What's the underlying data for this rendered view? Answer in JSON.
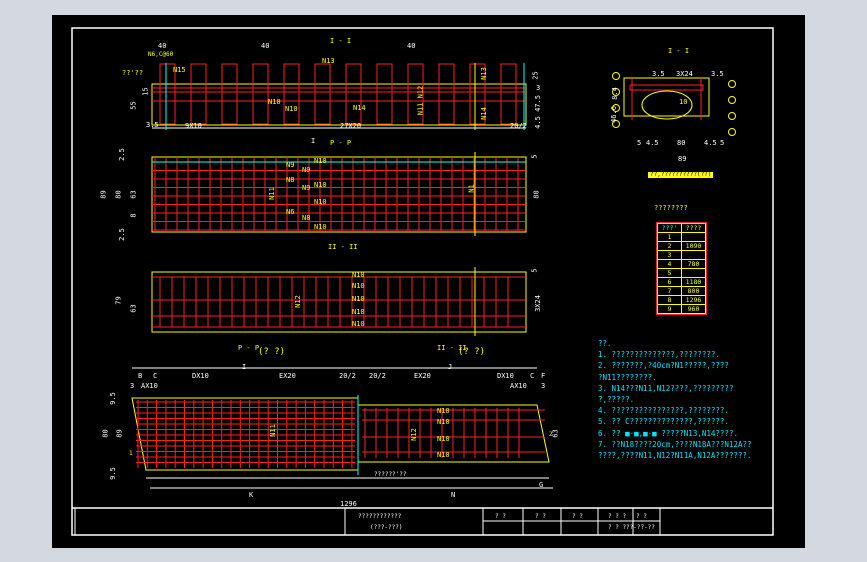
{
  "colors": {
    "background": "#000000",
    "frame": "#ffffff",
    "concrete": "#ffff00",
    "rebar": "#ff2020",
    "axis": "#00ffff",
    "outer": "#d4d8e0"
  },
  "elevation": {
    "title": "I - I",
    "dims_top": [
      "40",
      "40",
      "40"
    ],
    "note_top": "N6,C@60",
    "label_left": "??'??",
    "labels": [
      "N15",
      "N13",
      "N10",
      "N10",
      "N14",
      "N11 N12",
      "N13",
      "N14"
    ],
    "dims_left": [
      "55",
      "15"
    ],
    "dims_right": [
      "25",
      "3",
      "47.5",
      "4.5"
    ],
    "dims_bottom": [
      "3.5",
      "9X10",
      "27X20",
      "20/2"
    ]
  },
  "plan_pp": {
    "title": "P - P",
    "marker": "I",
    "labels": [
      "N9",
      "N9",
      "N10",
      "N8",
      "N9",
      "N10",
      "N11",
      "N6",
      "N8",
      "N10",
      "N10",
      "N1"
    ],
    "dims_left": [
      "2.5",
      "89",
      "80",
      "63",
      "8",
      "2.5"
    ],
    "dims_right": [
      "5",
      "80"
    ]
  },
  "section_ii": {
    "title": "II - II",
    "labels": [
      "N10",
      "N10",
      "N12",
      "N10",
      "N10",
      "N10"
    ],
    "dims_left": [
      "79",
      "63"
    ],
    "dims_right": [
      "5",
      "3X24"
    ]
  },
  "section_i": {
    "title": "I - I",
    "dims_top": [
      "3.5",
      "3X24",
      "3.5"
    ],
    "dims_left": [
      "8.4",
      "46.6"
    ],
    "dims_bottom": [
      "5",
      "4.5",
      "80",
      "4.5",
      "5",
      "89"
    ],
    "center_label": "10",
    "caption": "??,??????????(??)",
    "callouts": [
      "1",
      "2",
      "3",
      "4",
      "5",
      "6",
      "7",
      "8",
      "9",
      "10",
      "11",
      "12",
      "13"
    ]
  },
  "bottom_plan": {
    "title_left": "P - P",
    "title_left_suffix": "(? ?)",
    "title_right": "II - II",
    "title_right_suffix": "(? ?)",
    "dims_top_row1": [
      "I",
      "J"
    ],
    "dims_top_row2": [
      "B",
      "C",
      "DX10",
      "EX20",
      "20/2",
      "20/2",
      "EX20",
      "DX10",
      "C",
      "F"
    ],
    "dims_top_row3": [
      "3",
      "AX10",
      "AX10",
      "3"
    ],
    "dims_left": [
      "9.5",
      "80",
      "89",
      "9.5"
    ],
    "dims_right": [
      "63"
    ],
    "labels": [
      "N11",
      "N12",
      "N10",
      "N10",
      "N10",
      "N10"
    ],
    "callouts": [
      "1",
      "2"
    ],
    "note": "??????'??",
    "dims_bottom": [
      "K",
      "N",
      "G",
      "1296"
    ]
  },
  "table": {
    "title": "????????",
    "headers": [
      "???'",
      "????"
    ],
    "rows": [
      [
        "1",
        ""
      ],
      [
        "2",
        "1090"
      ],
      [
        "3",
        ""
      ],
      [
        "4",
        "780"
      ],
      [
        "5",
        ""
      ],
      [
        "6",
        "1180"
      ],
      [
        "7",
        "800"
      ],
      [
        "8",
        "1296"
      ],
      [
        "9",
        "960"
      ]
    ]
  },
  "notes": {
    "heading": "??.",
    "items": [
      "1. ??????????????,????????.",
      "2. ???????,?40cm?N1?????,????",
      "   ?N11????????.",
      "3. N14???N11,N12????,?????????",
      "   ?,?????.",
      "4. ????????????????,????????.",
      "5. ?? C??????????????,??????.",
      "6. ?? ■·■,■·■ ?????N13,N14????.",
      "7. ??N18????20cm,????N18A???N12A??",
      "   ????,????N11,N12?N11A,N12A???????."
    ]
  },
  "title_block": {
    "title_line1": "????????????",
    "title_line2": "(???-???)",
    "cells": [
      "? ?",
      "? ?",
      "? ?",
      "? ? ?",
      "? ?",
      "? ? ?",
      "??-??-??"
    ]
  }
}
